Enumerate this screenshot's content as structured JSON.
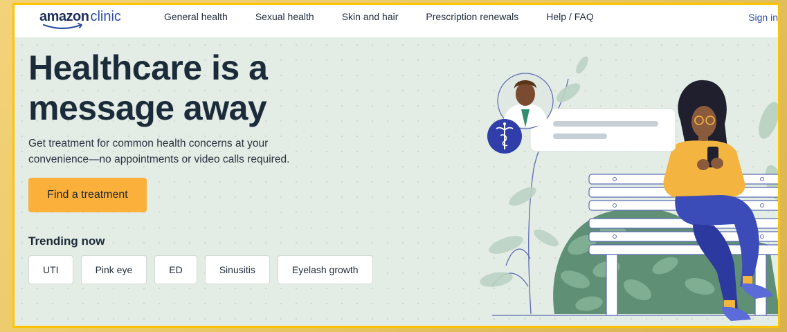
{
  "brand": {
    "name_bold": "amazon",
    "name_light": "clinic"
  },
  "nav": {
    "links": [
      "General health",
      "Sexual health",
      "Skin and hair",
      "Prescription renewals",
      "Help / FAQ"
    ],
    "sign_in": "Sign in"
  },
  "hero": {
    "headline": "Healthcare is a message away",
    "subtext": "Get treatment for common health concerns at your convenience—no appointments or video calls required.",
    "cta_label": "Find a treatment"
  },
  "trending": {
    "title": "Trending now",
    "items": [
      "UTI",
      "Pink eye",
      "ED",
      "Sinusitis",
      "Eyelash growth"
    ]
  },
  "colors": {
    "frame": "#ffc400",
    "hero_bg": "#e3ece5",
    "cta": "#fbb03b",
    "brand_navy": "#1e2f5c",
    "accent_blue": "#2d4fa3"
  },
  "icons": {
    "logo_smile": "amazon-smile-icon",
    "medical_badge": "caduceus-icon",
    "illustration": "patient-on-bench-illustration"
  }
}
